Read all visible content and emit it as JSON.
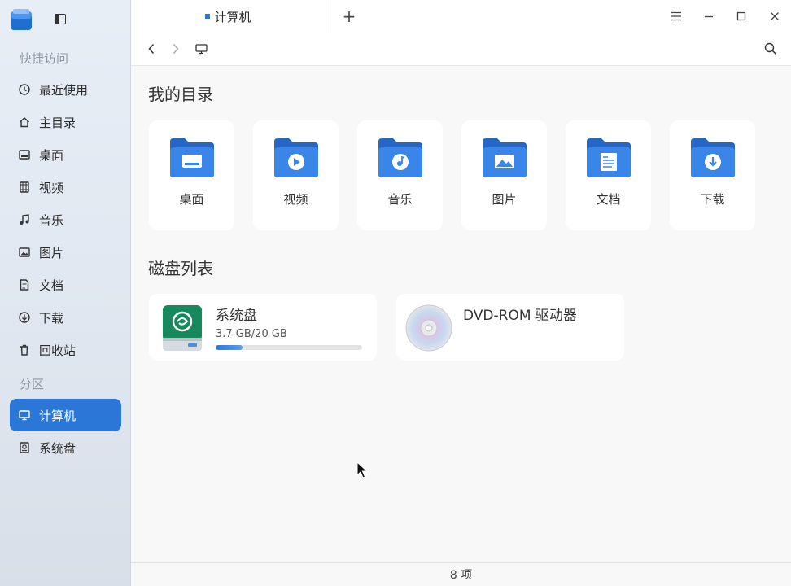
{
  "sidebar": {
    "quick_access_label": "快捷访问",
    "partitions_label": "分区",
    "items": [
      {
        "label": "最近使用",
        "icon": "clock-icon"
      },
      {
        "label": "主目录",
        "icon": "home-icon"
      },
      {
        "label": "桌面",
        "icon": "desktop-icon"
      },
      {
        "label": "视频",
        "icon": "video-icon"
      },
      {
        "label": "音乐",
        "icon": "music-icon"
      },
      {
        "label": "图片",
        "icon": "picture-icon"
      },
      {
        "label": "文档",
        "icon": "document-icon"
      },
      {
        "label": "下载",
        "icon": "download-icon"
      },
      {
        "label": "回收站",
        "icon": "trash-icon"
      }
    ],
    "partitions": [
      {
        "label": "计算机",
        "icon": "computer-icon",
        "active": true
      },
      {
        "label": "系统盘",
        "icon": "disk-icon",
        "active": false
      }
    ]
  },
  "titlebar": {
    "tab_title": "计算机",
    "new_tab": "+"
  },
  "main": {
    "my_directory_heading": "我的目录",
    "folders": [
      {
        "label": "桌面",
        "icon": "desktop-folder-icon"
      },
      {
        "label": "视频",
        "icon": "video-folder-icon"
      },
      {
        "label": "音乐",
        "icon": "music-folder-icon"
      },
      {
        "label": "图片",
        "icon": "picture-folder-icon"
      },
      {
        "label": "文档",
        "icon": "document-folder-icon"
      },
      {
        "label": "下载",
        "icon": "download-folder-icon"
      }
    ],
    "disk_list_heading": "磁盘列表",
    "disks": [
      {
        "name": "系统盘",
        "size": "3.7 GB/20 GB",
        "usage_fraction": 0.185
      },
      {
        "name": "DVD-ROM 驱动器"
      }
    ]
  },
  "statusbar": {
    "item_count": "8 项"
  },
  "colors": {
    "accent": "#2a77d8",
    "folder_blue": "#3a86e8"
  }
}
